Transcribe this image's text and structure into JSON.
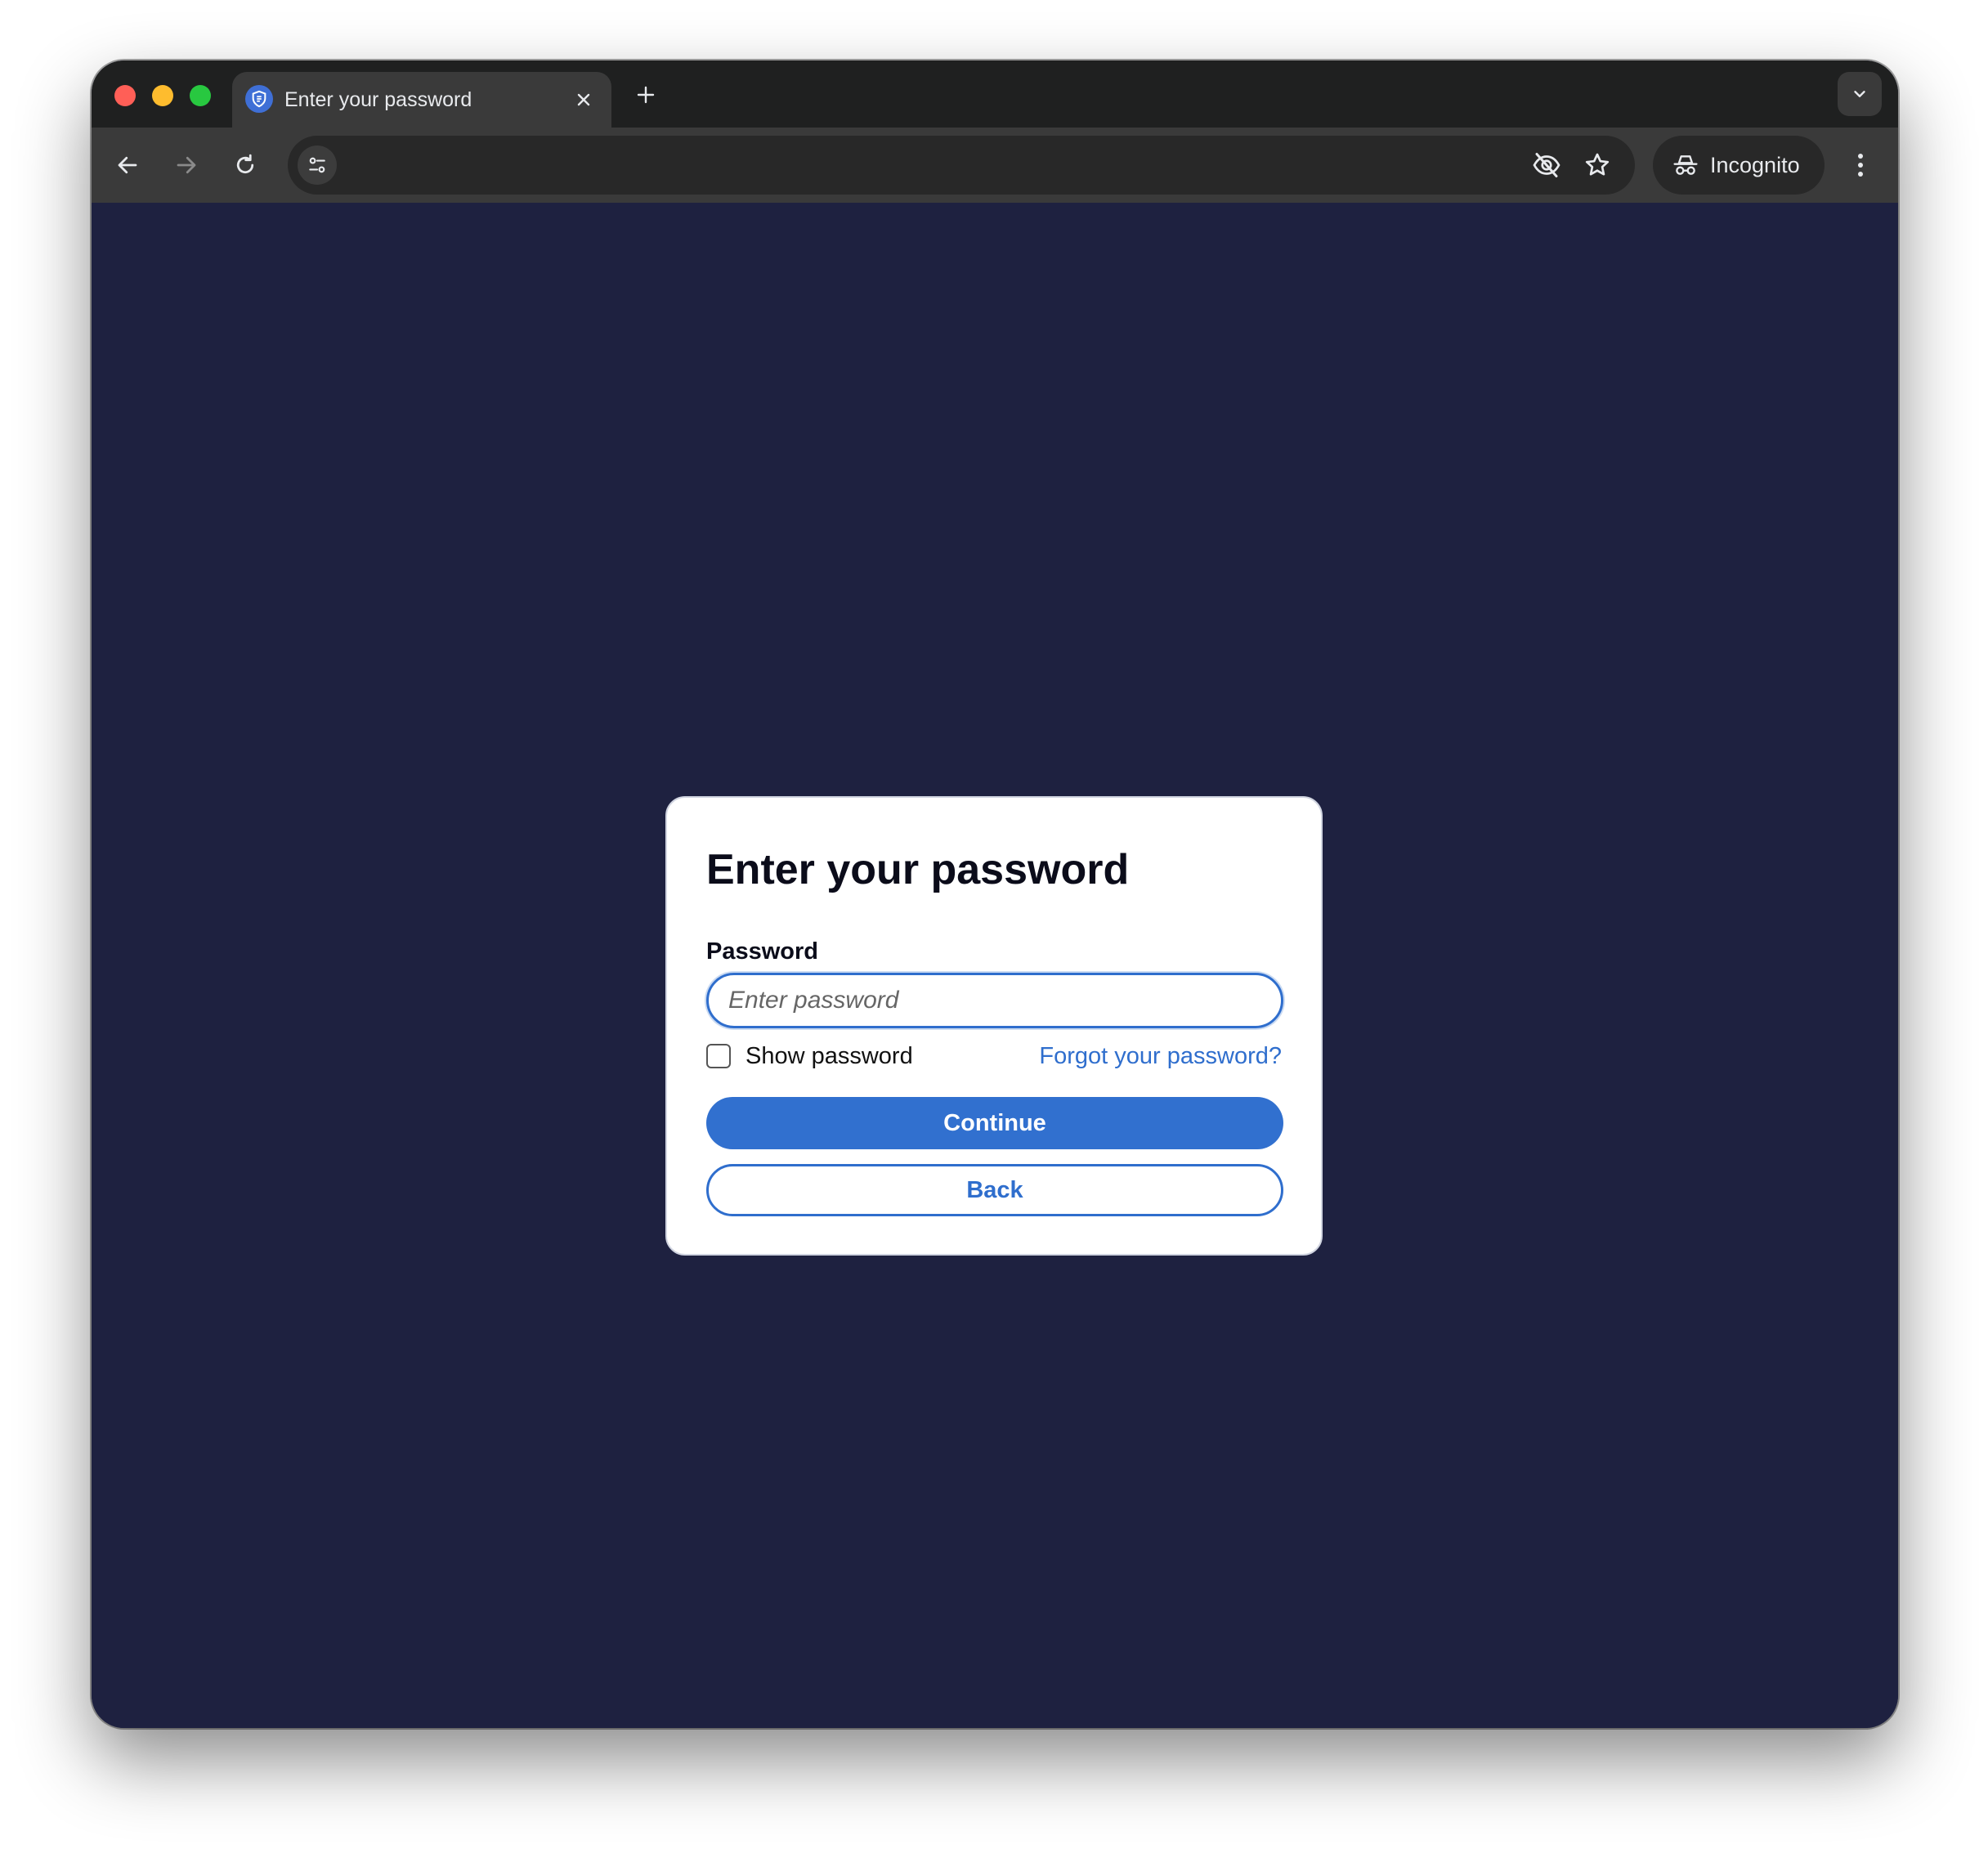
{
  "browser": {
    "tab": {
      "title": "Enter your password",
      "favicon": "shield-icon"
    },
    "incognito_label": "Incognito",
    "icons": {
      "back": "arrow-left-icon",
      "forward": "arrow-right-icon",
      "reload": "reload-icon",
      "site_info": "tune-icon",
      "tracking": "eye-off-icon",
      "bookmark": "star-icon",
      "menu": "kebab-icon"
    }
  },
  "page": {
    "background_color": "#1e2140",
    "accent_color": "#3170cf"
  },
  "login": {
    "title": "Enter your password",
    "password_label": "Password",
    "password_value": "",
    "password_placeholder": "Enter password",
    "show_password_label": "Show password",
    "show_password_checked": false,
    "forgot_link": "Forgot your password?",
    "continue_label": "Continue",
    "back_label": "Back"
  }
}
